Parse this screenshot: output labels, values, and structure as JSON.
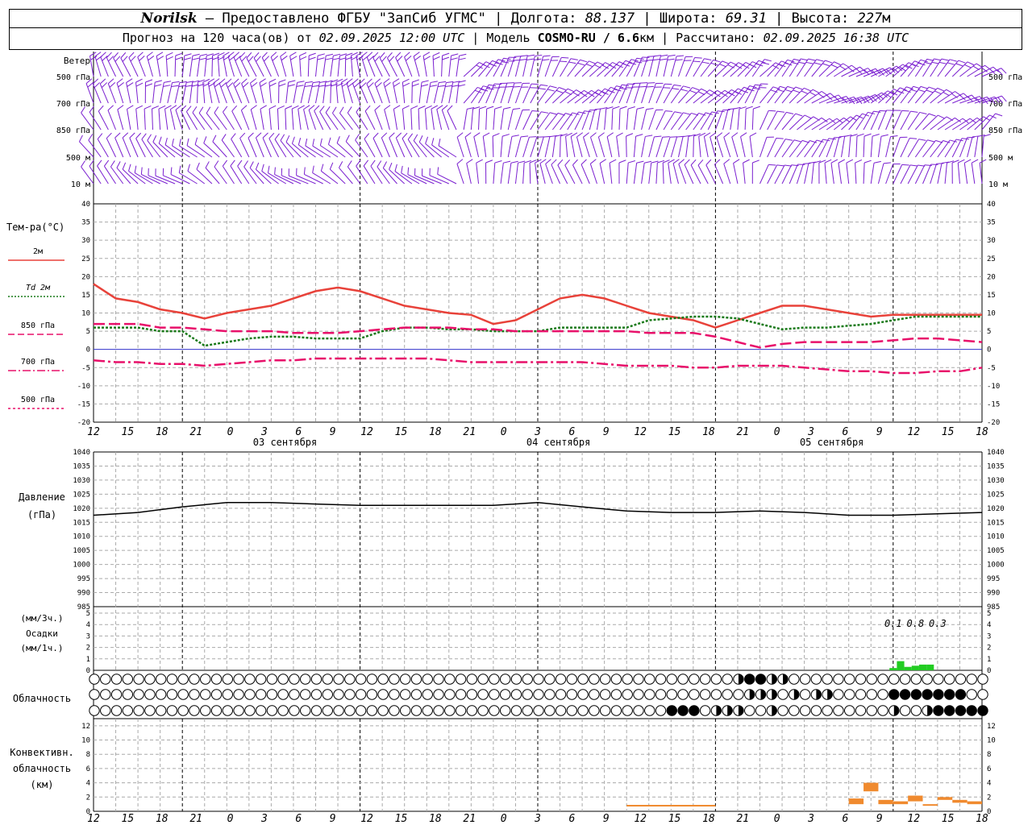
{
  "header": {
    "station": "Norilsk",
    "provider": " – Предоставлено ФГБУ \"ЗапСиб УГМС\" | Долгота: ",
    "lon": "88.137",
    "lat_label": " | Широта: ",
    "lat": "69.31",
    "alt_label": " | Высота: ",
    "alt": "227",
    "alt_unit": "м",
    "forecast_prefix": "Прогноз на 120 часа(ов) от ",
    "forecast_time": "02.09.2025 12:00 UTC",
    "model_label": " | Модель ",
    "model_name": "COSMO-RU / 6.6",
    "model_unit": "км",
    "calc_label": " | Рассчитано: ",
    "calc_time": "02.09.2025 16:38 UTC"
  },
  "chart_data": {
    "type": "meteogram",
    "x_hours": [
      12,
      15,
      18,
      21,
      0,
      3,
      6,
      9,
      12,
      15,
      18,
      21,
      0,
      3,
      6,
      9,
      12,
      15,
      18,
      21,
      0,
      3,
      6,
      9,
      12,
      15,
      18
    ],
    "day_labels": [
      {
        "text": "03 сентября",
        "after_tick": 4
      },
      {
        "text": "04 сентября",
        "after_tick": 12
      },
      {
        "text": "05 сентября",
        "after_tick": 20
      }
    ],
    "wind": {
      "title": "Ветер",
      "levels": [
        "500 гПа",
        "700 гПа",
        "850 гПа",
        "500 м",
        "10 м"
      ],
      "color": "#7a1fd0",
      "note": "barbs every hour, 121 steps"
    },
    "temperature": {
      "title": "Тем-ра(°С)",
      "ylim": [
        -20,
        40
      ],
      "ticks": [
        40,
        35,
        30,
        25,
        20,
        15,
        10,
        5,
        0,
        -5,
        -10,
        -15,
        -20
      ],
      "legend": [
        "2м",
        "Td 2м",
        "850 гПа",
        "700 гПа",
        "500 гПа"
      ],
      "series": [
        {
          "name": "2м",
          "color": "#e8423a",
          "style": "solid",
          "t": [
            0,
            3,
            6,
            9,
            12,
            15,
            18,
            21,
            24,
            27,
            30,
            33,
            36,
            39,
            42,
            45,
            48,
            51,
            54,
            57,
            60,
            63,
            66,
            69,
            72,
            75,
            78,
            81,
            84,
            87,
            90,
            93,
            96,
            99,
            102,
            105,
            108,
            111,
            114,
            117,
            120
          ],
          "v": [
            18,
            14,
            13,
            11,
            10,
            8.5,
            10,
            11,
            12,
            14,
            16,
            17,
            16,
            14,
            12,
            11,
            10,
            9.5,
            7,
            8,
            11,
            14,
            15,
            14,
            12,
            10,
            9,
            8,
            6,
            8,
            10,
            12,
            12,
            11,
            10,
            9,
            9.5,
            9.5,
            9.5,
            9.5,
            9.5
          ]
        },
        {
          "name": "Td 2м",
          "color": "#1a7a1a",
          "style": "dotted",
          "t": [
            0,
            3,
            6,
            9,
            12,
            15,
            18,
            21,
            24,
            27,
            30,
            33,
            36,
            39,
            42,
            45,
            48,
            51,
            54,
            57,
            60,
            63,
            66,
            69,
            72,
            75,
            78,
            81,
            84,
            87,
            90,
            93,
            96,
            99,
            102,
            105,
            108,
            111,
            114,
            117,
            120
          ],
          "v": [
            6,
            6,
            6,
            5,
            5,
            1,
            2,
            3,
            3.5,
            3.5,
            3,
            3,
            3,
            5,
            6,
            6,
            5.5,
            5.5,
            5,
            5,
            5,
            6,
            6,
            6,
            6,
            8,
            8.5,
            9,
            9,
            8.5,
            7,
            5.5,
            6,
            6,
            6.5,
            7,
            8,
            9,
            9,
            9,
            9
          ]
        },
        {
          "name": "850 гПа",
          "color": "#e8106a",
          "style": "dashed",
          "t": [
            0,
            3,
            6,
            9,
            12,
            15,
            18,
            21,
            24,
            27,
            30,
            33,
            36,
            39,
            42,
            45,
            48,
            51,
            54,
            57,
            60,
            63,
            66,
            69,
            72,
            75,
            78,
            81,
            84,
            87,
            90,
            93,
            96,
            99,
            102,
            105,
            108,
            111,
            114,
            117,
            120
          ],
          "v": [
            7,
            7,
            7,
            6,
            6,
            5.5,
            5,
            5,
            5,
            4.5,
            4.5,
            4.5,
            5,
            5.5,
            6,
            6,
            6,
            5.5,
            5.5,
            5,
            5,
            5,
            5,
            5,
            5,
            4.5,
            4.5,
            4.5,
            3.5,
            2,
            0.5,
            1.5,
            2,
            2,
            2,
            2,
            2.5,
            3,
            3,
            2.5,
            2
          ]
        },
        {
          "name": "700 гПа",
          "color": "#e8106a",
          "style": "dashdot",
          "t": [
            0,
            3,
            6,
            9,
            12,
            15,
            18,
            21,
            24,
            27,
            30,
            33,
            36,
            39,
            42,
            45,
            48,
            51,
            54,
            57,
            60,
            63,
            66,
            69,
            72,
            75,
            78,
            81,
            84,
            87,
            90,
            93,
            96,
            99,
            102,
            105,
            108,
            111,
            114,
            117,
            120
          ],
          "v": [
            -3,
            -3.5,
            -3.5,
            -4,
            -4,
            -4.5,
            -4,
            -3.5,
            -3,
            -3,
            -2.5,
            -2.5,
            -2.5,
            -2.5,
            -2.5,
            -2.5,
            -3,
            -3.5,
            -3.5,
            -3.5,
            -3.5,
            -3.5,
            -3.5,
            -4,
            -4.5,
            -4.5,
            -4.5,
            -5,
            -5,
            -4.5,
            -4.5,
            -4.5,
            -5,
            -5.5,
            -6,
            -6,
            -6.5,
            -6.5,
            -6,
            -6,
            -5
          ]
        }
      ]
    },
    "pressure": {
      "title": "Давление",
      "unit": "(гПа)",
      "ylim": [
        985,
        1040
      ],
      "ticks": [
        1040,
        1035,
        1030,
        1025,
        1020,
        1015,
        1010,
        1005,
        1000,
        995,
        990,
        985
      ],
      "t": [
        0,
        6,
        12,
        18,
        24,
        30,
        36,
        42,
        48,
        54,
        60,
        66,
        72,
        78,
        84,
        90,
        96,
        102,
        108,
        114,
        120
      ],
      "v": [
        1017.5,
        1018.5,
        1020.5,
        1022,
        1022,
        1021.5,
        1021,
        1021,
        1021,
        1021,
        1022,
        1020.5,
        1019,
        1018.5,
        1018.5,
        1019,
        1018.5,
        1017.5,
        1017.5,
        1018,
        1018.5
      ]
    },
    "precip": {
      "title": "Осадки",
      "unit_3h": "(мм/3ч.)",
      "unit_1h": "(мм/1ч.)",
      "ylim": [
        0,
        5
      ],
      "ticks": [
        5,
        4,
        3,
        2,
        1,
        0
      ],
      "sums": [
        {
          "label": "0.1",
          "hour": 108
        },
        {
          "label": "0.8",
          "hour": 111
        },
        {
          "label": "0.3",
          "hour": 114
        }
      ],
      "bars": [
        {
          "hour": 108,
          "value": 0.2
        },
        {
          "hour": 109,
          "value": 0.8
        },
        {
          "hour": 110,
          "value": 0.3
        },
        {
          "hour": 111,
          "value": 0.4
        },
        {
          "hour": 112,
          "value": 0.5
        },
        {
          "hour": 113,
          "value": 0.5
        }
      ],
      "color": "#22cc22"
    },
    "clouds": {
      "title": "Облачность",
      "rows": [
        {
          "name": "high",
          "filled_ranges": [
            [
              88,
              91
            ]
          ],
          "partial": [
            87,
            92,
            93
          ]
        },
        {
          "name": "middle",
          "filled_ranges": [
            [
              107,
              118
            ]
          ],
          "partial": [
            88,
            90,
            92,
            94,
            97,
            99
          ]
        },
        {
          "name": "low",
          "filled_ranges": [
            [
              78,
              82
            ],
            [
              113,
              120
            ]
          ],
          "partial": [
            84,
            86,
            87,
            91,
            108,
            112
          ]
        }
      ]
    },
    "convective": {
      "title": "Конвективн.",
      "title2": "облачность",
      "unit": "(км)",
      "ylim": [
        0,
        13
      ],
      "ticks": [
        12,
        10,
        8,
        6,
        4,
        2,
        0
      ],
      "color": "#f08a2e",
      "bars": [
        {
          "h0": 72,
          "h1": 78,
          "low": 0.8,
          "high": 0.9
        },
        {
          "h0": 78,
          "h1": 84,
          "low": 0.7,
          "high": 0.9
        },
        {
          "h0": 102,
          "h1": 104,
          "low": 1.0,
          "high": 1.8
        },
        {
          "h0": 104,
          "h1": 106,
          "low": 2.8,
          "high": 4.0
        },
        {
          "h0": 106,
          "h1": 108,
          "low": 1.0,
          "high": 1.6
        },
        {
          "h0": 108,
          "h1": 110,
          "low": 1.0,
          "high": 1.4
        },
        {
          "h0": 110,
          "h1": 112,
          "low": 1.4,
          "high": 2.2
        },
        {
          "h0": 112,
          "h1": 114,
          "low": 0.8,
          "high": 1.0
        },
        {
          "h0": 114,
          "h1": 116,
          "low": 1.6,
          "high": 2.0
        },
        {
          "h0": 116,
          "h1": 118,
          "low": 1.2,
          "high": 1.6
        },
        {
          "h0": 118,
          "h1": 120,
          "low": 1.0,
          "high": 1.4
        },
        {
          "h0": 120,
          "h1": 124,
          "low": 1.2,
          "high": 1.8
        }
      ]
    }
  }
}
